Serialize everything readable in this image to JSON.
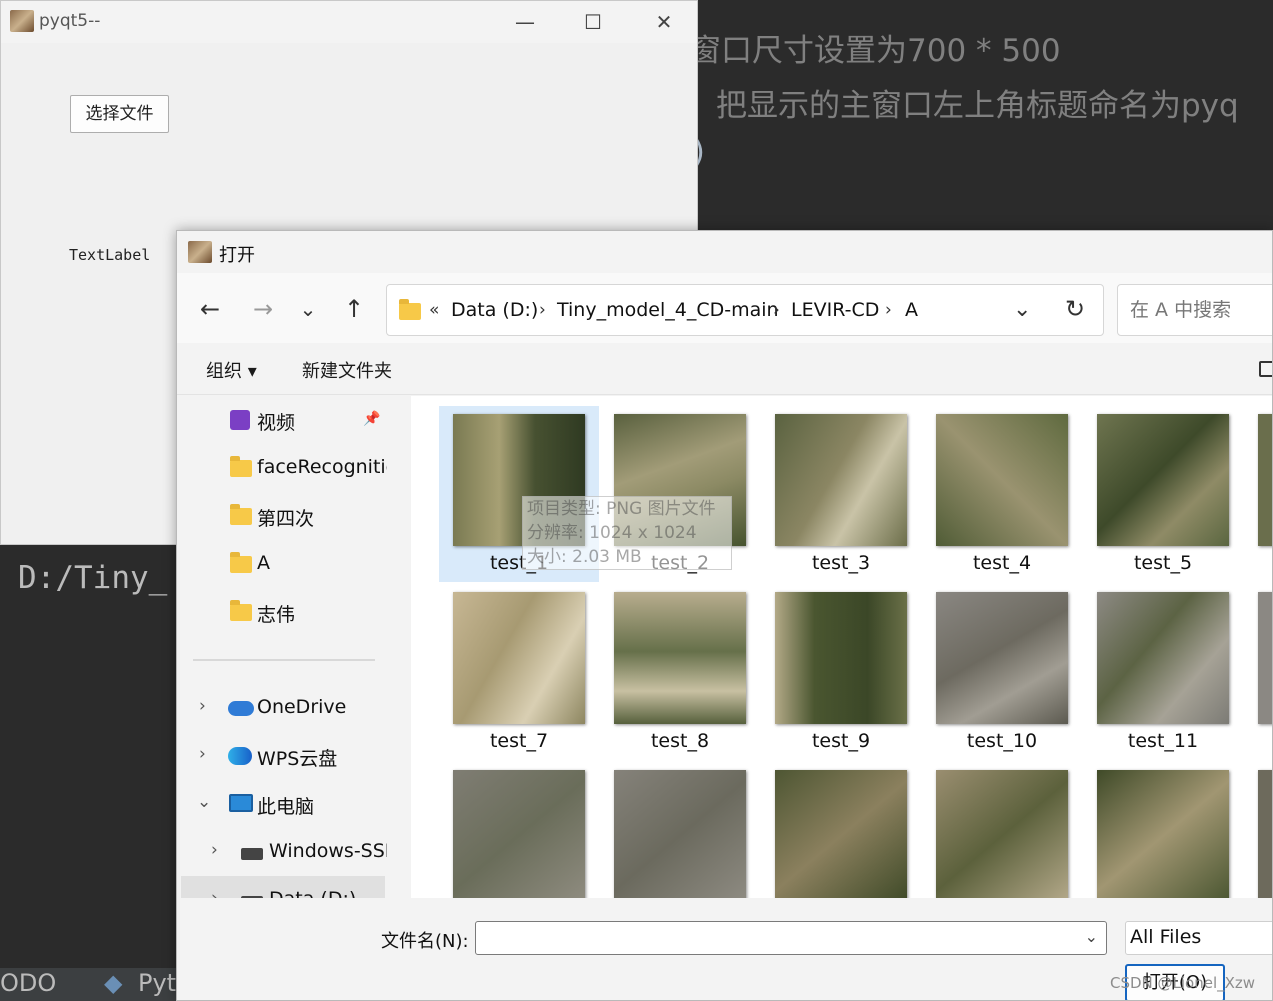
{
  "ide": {
    "line1": "窗口尺寸设置为700 * 500",
    "line2": "把显示的主窗口左上角标题命名为pyq",
    "line3": ")",
    "terminal": "D:/Tiny_",
    "bottom_todo": "ODO",
    "bottom_python": "Pyt"
  },
  "pyqt": {
    "title": "pyqt5--",
    "button_label": "选择文件",
    "text_label": "TextLabel",
    "minimize": "—",
    "maximize": "☐",
    "close": "✕"
  },
  "dialog": {
    "title": "打开",
    "nav": {
      "back": "←",
      "forward": "→",
      "recent": "⌄",
      "up": "↑"
    },
    "address": {
      "overflow": "«",
      "crumbs": [
        "Data (D:)",
        "Tiny_model_4_CD-main",
        "LEVIR-CD",
        "A"
      ],
      "sep": "›",
      "dropdown": "⌄",
      "refresh": "↻"
    },
    "search_placeholder": "在 A 中搜索",
    "toolbar": {
      "organize": "组织 ▾",
      "new_folder": "新建文件夹"
    },
    "sidebar": [
      {
        "label": "视频",
        "pin": "📌"
      },
      {
        "label": "faceRecognitio"
      },
      {
        "label": "第四次"
      },
      {
        "label": "A"
      },
      {
        "label": "志伟"
      },
      {
        "label": "OneDrive",
        "chev": "›"
      },
      {
        "label": "WPS云盘",
        "chev": "›"
      },
      {
        "label": "此电脑",
        "chev": "⌄"
      },
      {
        "label": "Windows-SSD",
        "chev": "›"
      },
      {
        "label": "Data (D:)",
        "chev": "›"
      }
    ],
    "files": [
      "test_1",
      "test_2",
      "test_3",
      "test_4",
      "test_5",
      "test_7",
      "test_8",
      "test_9",
      "test_10",
      "test_11",
      "",
      "",
      "",
      "",
      ""
    ],
    "tooltip": [
      "项目类型: PNG 图片文件",
      "分辨率: 1024 x 1024",
      "大小: 2.03 MB"
    ],
    "filename_label": "文件名(N):",
    "filename_value": "",
    "filetype": "All Files",
    "open_label": "打开(O)"
  },
  "watermark": "CSDN @Lionel_Xzw",
  "colors": {
    "accent": "#1565c0",
    "selection": "#d9eafa",
    "folder": "#f7c948"
  }
}
